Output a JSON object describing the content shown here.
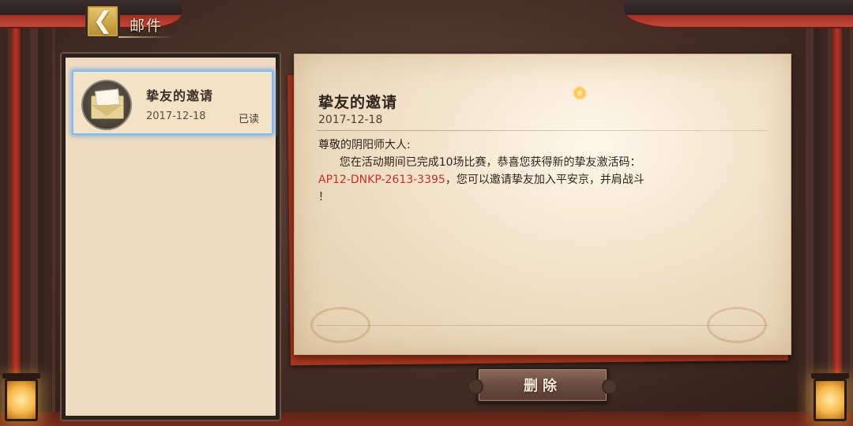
{
  "header": {
    "title": "邮件",
    "back_icon": "back-chevron-icon"
  },
  "mail_list": {
    "items": [
      {
        "title": "挚友的邀请",
        "date": "2017-12-18",
        "status": "已读",
        "icon": "envelope-icon",
        "selected": true
      }
    ]
  },
  "mail_detail": {
    "title": "挚友的邀请",
    "date": "2017-12-18",
    "greeting": "尊敬的阴阳师大人:",
    "line1": "      您在活动期间已完成10场比赛，恭喜您获得新的挚友激活码：",
    "code": "AP12-DNKP-2613-3395",
    "line2_rest": "，您可以邀请挚友加入平安京，并肩战斗",
    "line3": "！"
  },
  "actions": {
    "delete_label": "删除"
  },
  "colors": {
    "code_red": "#c0322a",
    "selection_blue": "#8fb8e0"
  }
}
